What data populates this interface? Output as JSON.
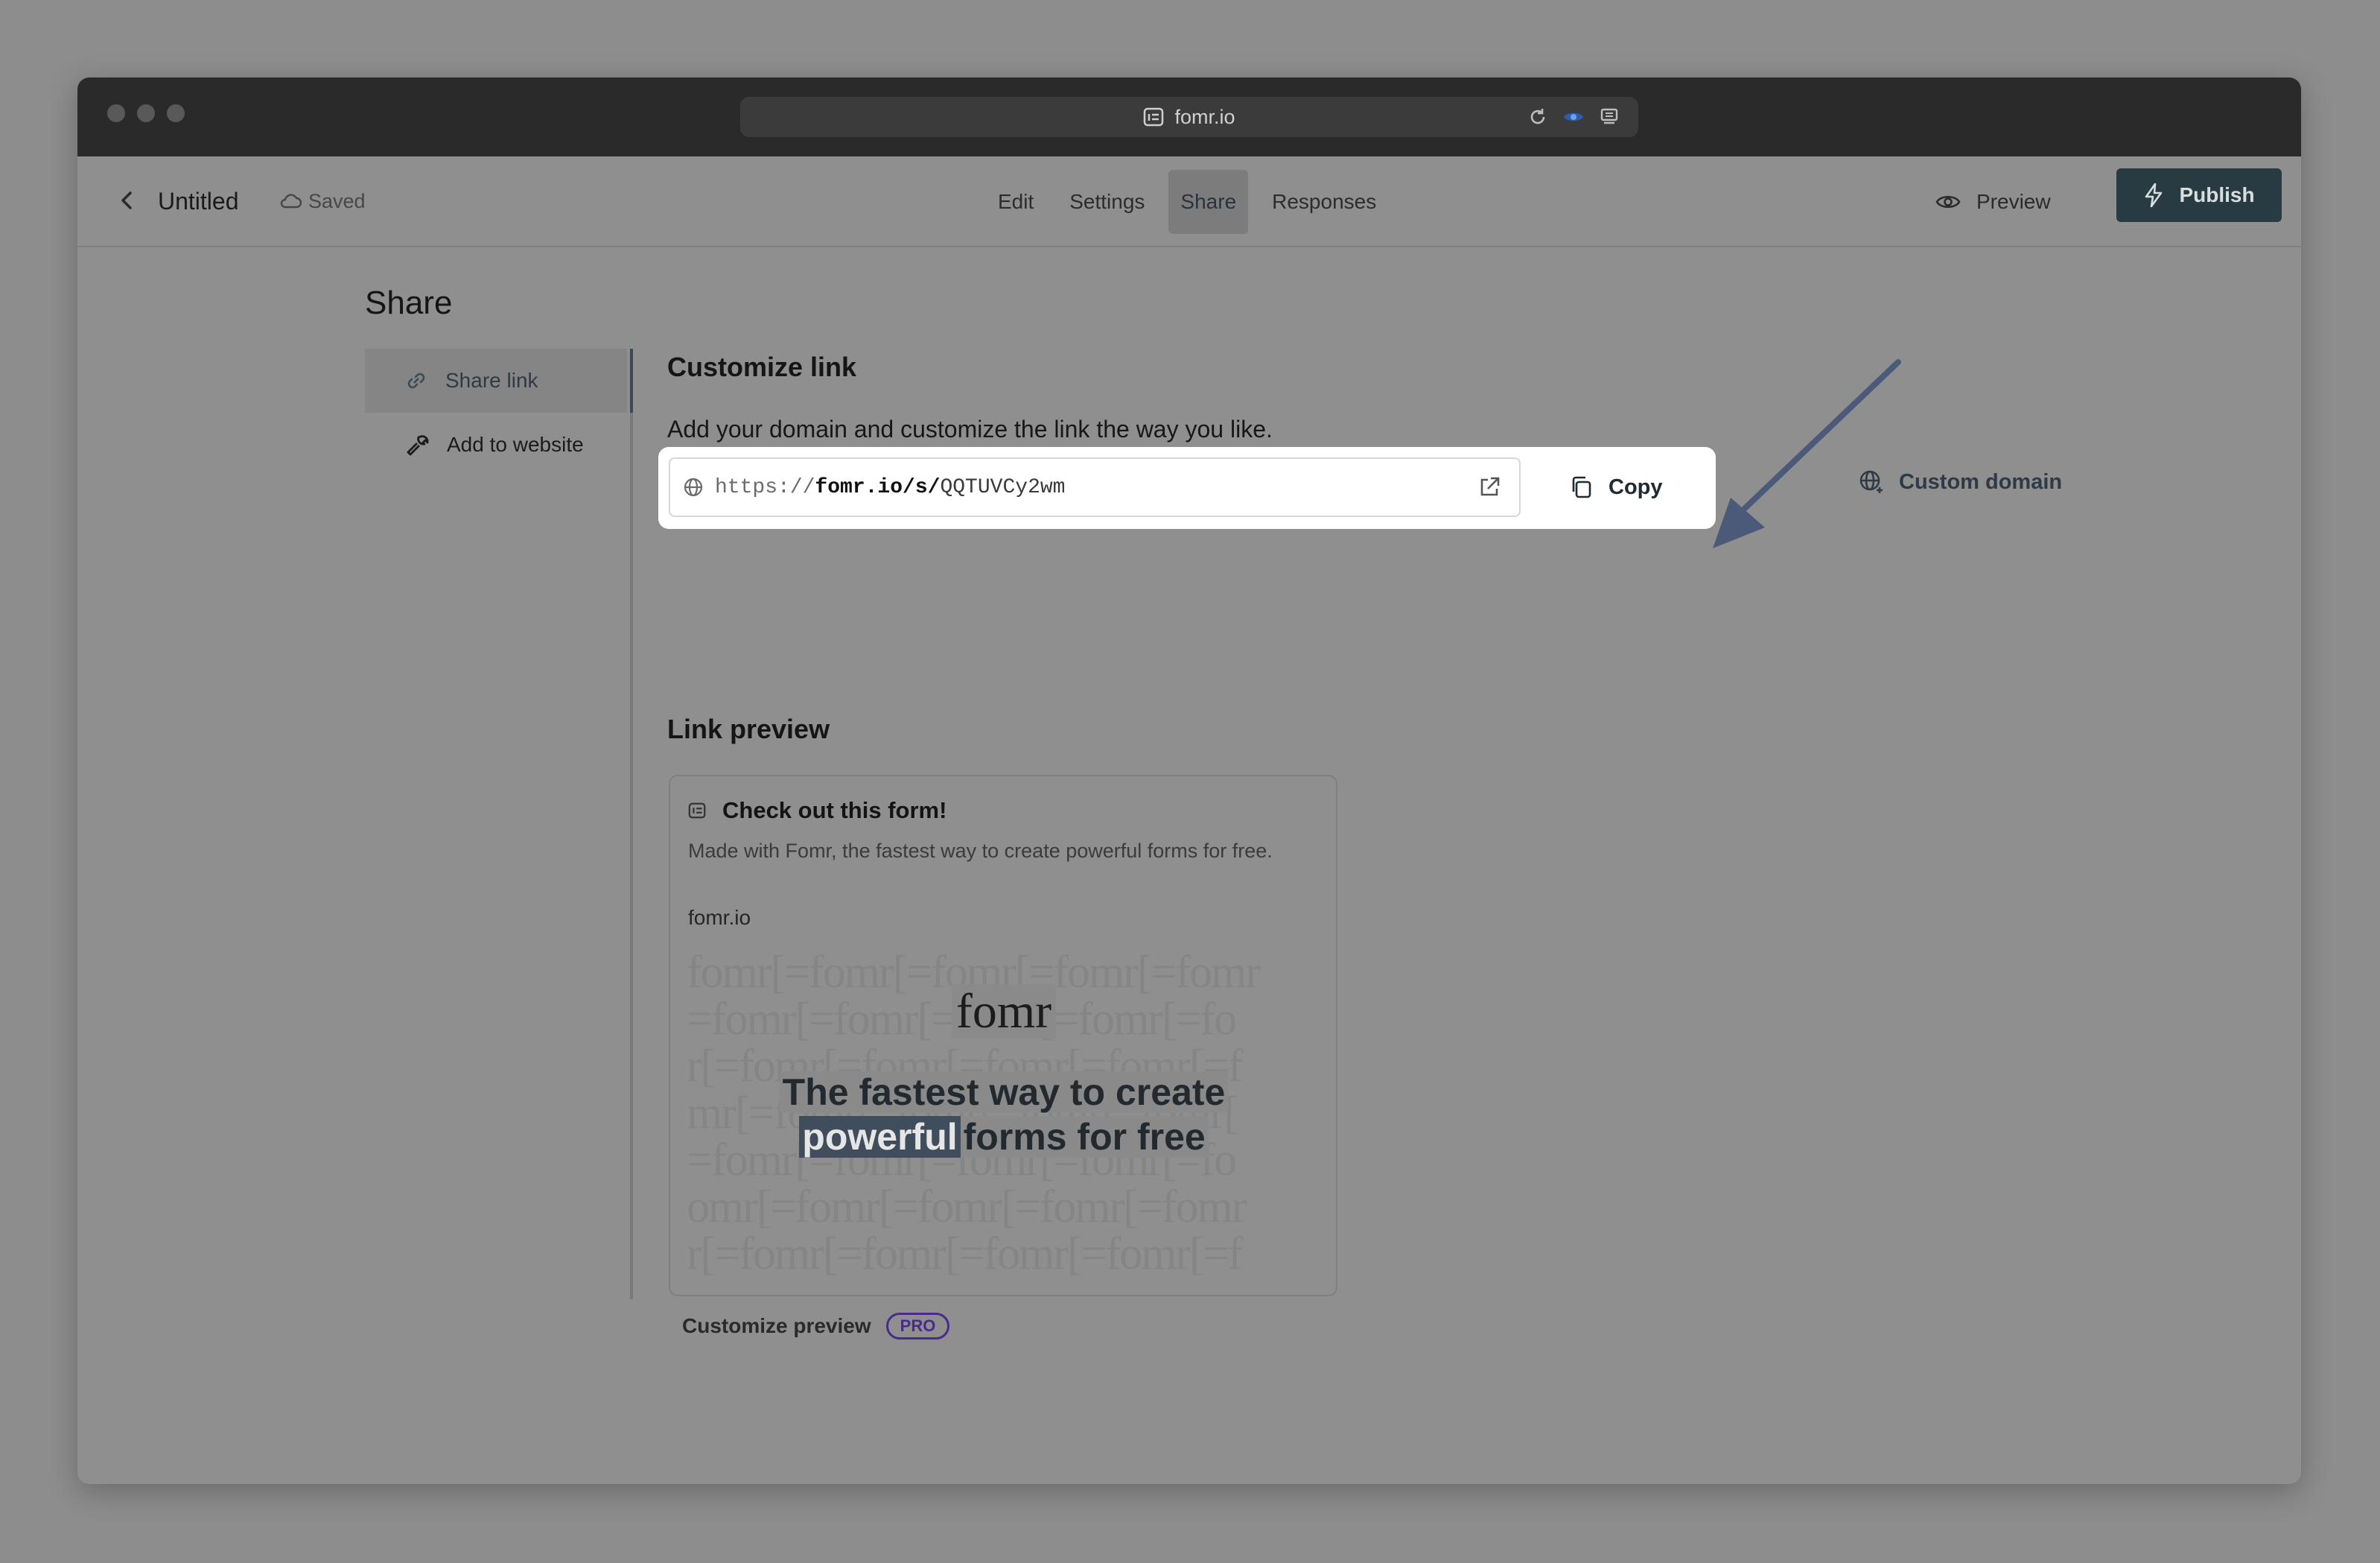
{
  "browser": {
    "url": "fomr.io"
  },
  "header": {
    "doc_title": "Untitled",
    "save_status": "Saved",
    "tabs": [
      {
        "label": "Edit"
      },
      {
        "label": "Settings"
      },
      {
        "label": "Share"
      },
      {
        "label": "Responses"
      }
    ],
    "active_tab": "Share",
    "preview_label": "Preview",
    "publish_label": "Publish"
  },
  "share": {
    "page_title": "Share",
    "side_items": [
      {
        "label": "Share link"
      },
      {
        "label": "Add to website"
      }
    ],
    "customize_title": "Customize link",
    "customize_desc": "Add your domain and customize the link the way you like.",
    "link": {
      "prefix": "https://",
      "host": "fomr.io/s/",
      "slug": "QQTUVCy2wm"
    },
    "copy_label": "Copy",
    "custom_domain_label": "Custom domain",
    "preview_title": "Link preview",
    "preview_card": {
      "title": "Check out this form!",
      "description": "Made with Fomr, the fastest way to create powerful forms for free.",
      "domain": "fomr.io",
      "logo_text": "fomr",
      "headline_line1": "The fastest way to create",
      "headline_highlight": "powerful",
      "headline_rest": "forms for free"
    },
    "customize_preview_label": "Customize preview",
    "pro_badge": "PRO"
  },
  "colors": {
    "publish_bg": "#283a42",
    "overlay_gray": "#8f8f8f",
    "arrow": "#4a5a78",
    "pro": "#4a2a8a"
  }
}
